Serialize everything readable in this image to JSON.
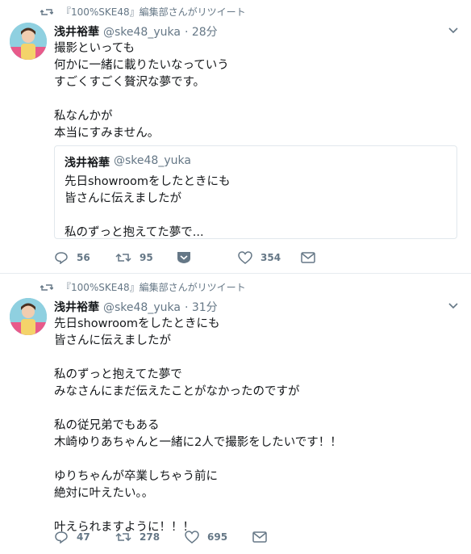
{
  "tweets": [
    {
      "retweet_by": "『100%SKE48』編集部さんがリツイート",
      "name": "浅井裕華",
      "handle": "@ske48_yuka",
      "time": "· 28分",
      "text": "撮影といっても\n何かに一緒に載りたいなっていう\nすごくすごく贅沢な夢です。\n\n私なんかが\n本当にすみません。",
      "quote": {
        "name": "浅井裕華",
        "handle": "@ske48_yuka",
        "text": "先日showroomをしたときにも\n皆さんに伝えましたが\n\n私のずっと抱えてた夢で..."
      },
      "replies": "56",
      "retweets": "95",
      "likes": "354"
    },
    {
      "retweet_by": "『100%SKE48』編集部さんがリツイート",
      "name": "浅井裕華",
      "handle": "@ske48_yuka",
      "time": "· 31分",
      "text": "先日showroomをしたときにも\n皆さんに伝えましたが\n\n私のずっと抱えてた夢で\nみなさんにまだ伝えたことがなかったのですが\n\n私の従兄弟でもある\n木崎ゆりあちゃんと一緒に2人で撮影をしたいです！！\n\nゆりちゃんが卒業しちゃう前に\n絶対に叶えたい。。\n\n叶えられますように！！！",
      "replies": "47",
      "retweets": "278",
      "likes": "695"
    }
  ],
  "colors": {
    "text": "#14171a",
    "muted": "#657786",
    "border": "#e6ecf0"
  }
}
